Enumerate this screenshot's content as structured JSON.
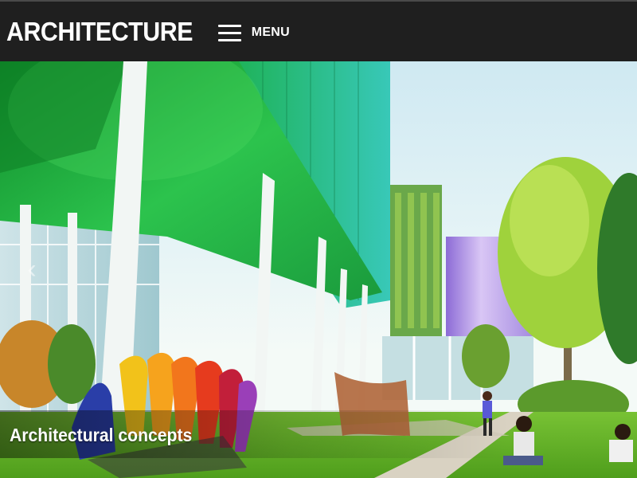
{
  "header": {
    "site_title": "ARCHITECTURE",
    "menu_label": "MENU"
  },
  "slider": {
    "caption": "Architectural concepts",
    "prev_icon": "chevron-left-icon"
  },
  "colors": {
    "header_bg": "#1f1f1f",
    "title_text": "#ffffff",
    "glass_green": "#2fb24a",
    "lawn_green": "#6cbb2a"
  }
}
